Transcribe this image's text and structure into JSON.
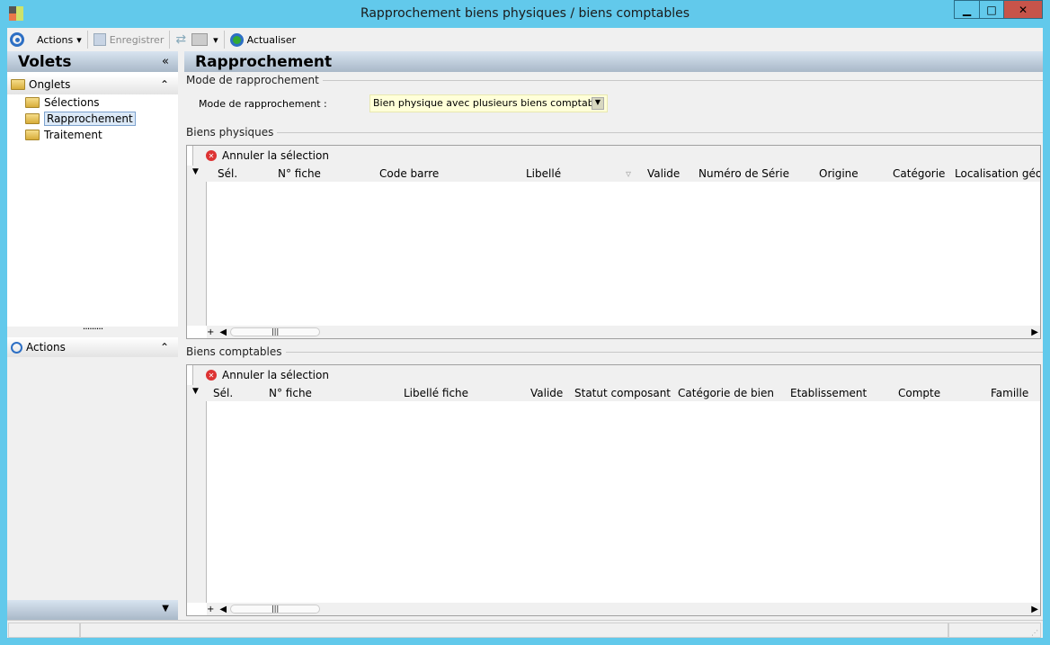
{
  "window": {
    "title": "Rapprochement biens physiques / biens comptables",
    "controls": [
      "minimize",
      "maximize",
      "close"
    ]
  },
  "toolbar": {
    "actions": "Actions",
    "save": "Enregistrer",
    "refresh": "Actualiser"
  },
  "left": {
    "title": "Volets",
    "collapse": "«",
    "onglets": "Onglets",
    "tree": [
      "Sélections",
      "Rapprochement",
      "Traitement"
    ],
    "selected": "Rapprochement",
    "actions": "Actions"
  },
  "main": {
    "title": "Rapprochement",
    "mode_group": "Mode de rapprochement",
    "mode_label": "Mode de rapprochement :",
    "mode_value": "Bien physique avec plusieurs biens comptable",
    "physiques": {
      "title": "Biens physiques",
      "cancel": "Annuler la sélection",
      "columns": [
        "Sél.",
        "N° fiche",
        "Code barre",
        "Libellé",
        "Valide",
        "Numéro de Série",
        "Origine",
        "Catégorie",
        "Localisation géog"
      ]
    },
    "comptables": {
      "title": "Biens comptables",
      "cancel": "Annuler la sélection",
      "columns": [
        "Sél.",
        "N° fiche",
        "Libellé fiche",
        "Valide",
        "Statut composant",
        "Catégorie de bien",
        "Etablissement",
        "Compte",
        "Famille"
      ]
    }
  },
  "colors": {
    "frame": "#62c9eb",
    "close": "#c7544a",
    "combo_bg": "#ffffd8"
  }
}
